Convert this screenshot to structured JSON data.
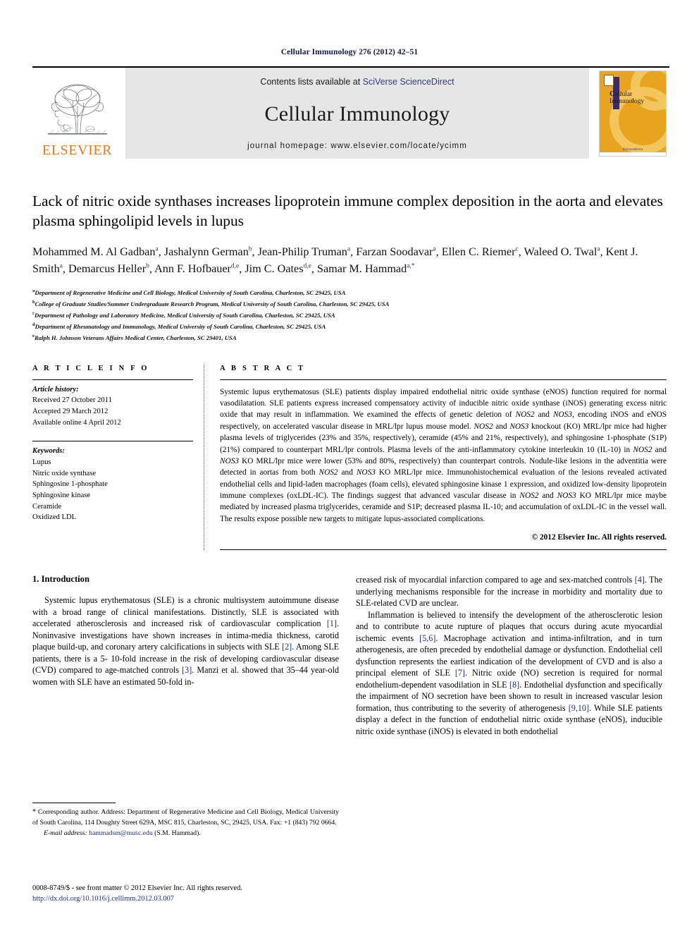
{
  "running_head": "Cellular Immunology 276 (2012) 42–51",
  "masthead": {
    "publisher_logo_label": "ELSEVIER",
    "contents_prefix": "Contents lists available at ",
    "contents_link": "SciVerse ScienceDirect",
    "journal_name": "Cellular Immunology",
    "homepage_label": "journal homepage: www.elsevier.com/locate/ycimm",
    "cover": {
      "title_first": "C",
      "title_rest": "ellular",
      "title_line2": "Immunology",
      "footer_text": "ScienceDirect"
    }
  },
  "article": {
    "title": "Lack of nitric oxide synthases increases lipoprotein immune complex deposition in the aorta and elevates plasma sphingolipid levels in lupus",
    "authors_html": "Mohammed M. Al Gadban<sup>a</sup>, Jashalynn German<sup>b</sup>, Jean-Philip Truman<sup>a</sup>, Farzan Soodavar<sup>a</sup>, Ellen C. Riemer<sup>c</sup>, Waleed O. Twal<sup>a</sup>, Kent J. Smith<sup>a</sup>, Demarcus Heller<sup>b</sup>, Ann F. Hofbauer<sup>d,e</sup>, Jim C. Oates<sup>d,e</sup>, Samar M. Hammad<sup>a,*</sup>",
    "affiliations": [
      {
        "mark": "a",
        "text": "Department of Regenerative Medicine and Cell Biology, Medical University of South Carolina, Charleston, SC 29425, USA"
      },
      {
        "mark": "b",
        "text": "College of Graduate Studies/Summer Undergraduate Research Program, Medical University of South Carolina, Charleston, SC 29425, USA"
      },
      {
        "mark": "c",
        "text": "Department of Pathology and Laboratory Medicine, Medical University of South Carolina, Charleston, SC 29425, USA"
      },
      {
        "mark": "d",
        "text": "Department of Rheumatology and Immunology, Medical University of South Carolina, Charleston, SC 29425, USA"
      },
      {
        "mark": "e",
        "text": "Ralph H. Johnson Veterans Affairs Medical Center, Charleston, SC 29401, USA"
      }
    ]
  },
  "article_info": {
    "heading": "A R T I C L E   I N F O",
    "history_label": "Article history:",
    "history": [
      "Received 27 October 2011",
      "Accepted 29 March 2012",
      "Available online 4 April 2012"
    ],
    "keywords_label": "Keywords:",
    "keywords": [
      "Lupus",
      "Nitric oxide synthase",
      "Sphingosine 1-phosphate",
      "Sphingosine kinase",
      "Ceramide",
      "Oxidized LDL"
    ]
  },
  "abstract": {
    "heading": "A B S T R A C T",
    "body_html": "Systemic lupus erythematosus (SLE) patients display impaired endothelial nitric oxide synthase (eNOS) function required for normal vasodilatation. SLE patients express increased compensatory activity of inducible nitric oxide synthase (iNOS) generating excess nitric oxide that may result in inflammation. We examined the effects of genetic deletion of <i>NOS2</i> and <i>NOS3</i>, encoding iNOS and eNOS respectively, on accelerated vascular disease in MRL/lpr lupus mouse model. <i>NOS2</i> and <i>NOS3</i> knockout (KO) MRL/lpr mice had higher plasma levels of triglycerides (23% and 35%, respectively), ceramide (45% and 21%, respectively), and sphingosine 1-phosphate (S1P) (21%) compared to counterpart MRL/lpr controls. Plasma levels of the anti-inflammatory cytokine interleukin 10 (IL-10) in <i>NOS2</i> and <i>NOS3</i> KO MRL/lpr mice were lower (53% and 80%, respectively) than counterpart controls. Nodule-like lesions in the adventitia were detected in aortas from both <i>NOS2</i> and <i>NOS3</i> KO MRL/lpr mice. Immunohistochemical evaluation of the lesions revealed activated endothelial cells and lipid-laden macrophages (foam cells), elevated sphingosine kinase 1 expression, and oxidized low-density lipoprotein immune complexes (oxLDL-IC). The findings suggest that advanced vascular disease in <i>NOS2</i> and <i>NOS3</i> KO MRL/lpr mice maybe mediated by increased plasma triglycerides, ceramide and S1P; decreased plasma IL-10; and accumulation of oxLDL-IC in the vessel wall. The results expose possible new targets to mitigate lupus-associated complications.",
    "copyright": "© 2012 Elsevier Inc. All rights reserved."
  },
  "introduction": {
    "heading": "1. Introduction",
    "left_html": "Systemic lupus erythematosus (SLE) is a chronic multisystem autoimmune disease with a broad range of clinical manifestations. Distinctly, SLE is associated with accelerated atherosclerosis and increased risk of cardiovascular complication <span class=\"ref\">[1]</span>. Noninvasive investigations have shown increases in intima-media thickness, carotid plaque build-up, and coronary artery calcifications in subjects with SLE <span class=\"ref\">[2]</span>. Among SLE patients, there is a 5- 10-fold increase in the risk of developing cardiovascular disease (CVD) compared to age-matched controls <span class=\"ref\">[3]</span>. Manzi et al. showed that 35–44 year-old women with SLE have an estimated 50-fold in-",
    "right_html_1": "creased risk of myocardial infarction compared to age and sex-matched controls <span class=\"ref\">[4]</span>. The underlying mechanisms responsible for the increase in morbidity and mortality due to SLE-related CVD are unclear.",
    "right_html_2": "Inflammation is believed to intensify the development of the atherosclerotic lesion and to contribute to acute rupture of plaques that occurs during acute myocardial ischemic events <span class=\"ref\">[5,6]</span>. Macrophage activation and intima-infiltration, and in turn atherogenesis, are often preceded by endothelial damage or dysfunction. Endothelial cell dysfunction represents the earliest indication of the development of CVD and is also a principal element of SLE <span class=\"ref\">[7]</span>. Nitric oxide (NO) secretion is required for normal endothelium-dependent vasodilation in SLE <span class=\"ref\">[8]</span>. Endothelial dysfunction and specifically the impairment of NO secretion have been shown to result in increased vascular lesion formation, thus contributing to the severity of atherogenesis <span class=\"ref\">[9,10]</span>. While SLE patients display a defect in the function of endothelial nitric oxide synthase (eNOS), inducible nitric oxide synthase (iNOS) is elevated in both endothelial"
  },
  "footnote": {
    "corresponding_html": "<span class=\"star\">*</span> Corresponding author. Address: Department of Regenerative Medicine and Cell Biology, Medical University of South Carolina, 114 Doughty Street 629A, MSC 815, Charleston, SC, 29425, USA. Fax: +1 (843) 792 0664.",
    "email_label": "E-mail address:",
    "email": "hammadsm@musc.edu",
    "email_suffix": "(S.M. Hammad)."
  },
  "issn_block": {
    "line1": "0008-8749/$ - see front matter © 2012 Elsevier Inc. All rights reserved.",
    "doi": "http://dx.doi.org/10.1016/j.cellimm.2012.03.007"
  },
  "colors": {
    "link_blue": "#1d2f8f",
    "elsevier_orange": "#E87722",
    "masthead_grey": "#e6e6e6",
    "cover_gold": "#E8A41E",
    "running_head_navy": "#111a4f"
  }
}
